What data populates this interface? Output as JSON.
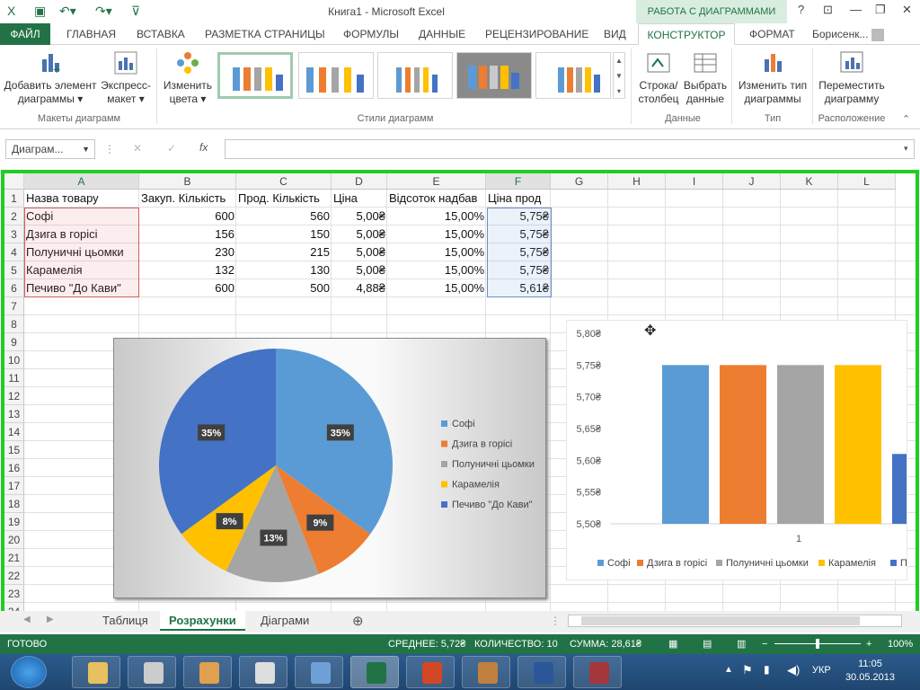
{
  "window": {
    "doc_title": "Книга1 - Microsoft Excel",
    "context_label": "РАБОТА С ДИАГРАММАМИ",
    "user": "Борисенк..."
  },
  "tabs": [
    "ФАЙЛ",
    "ГЛАВНАЯ",
    "ВСТАВКА",
    "РАЗМЕТКА СТРАНИЦЫ",
    "ФОРМУЛЫ",
    "ДАННЫЕ",
    "РЕЦЕНЗИРОВАНИЕ",
    "ВИД",
    "КОНСТРУКТОР",
    "ФОРМАТ"
  ],
  "ribbon": {
    "add_element_1": "Добавить элемент",
    "add_element_2": "диаграммы ▾",
    "express_1": "Экспресс-",
    "express_2": "макет ▾",
    "change_colors_1": "Изменить",
    "change_colors_2": "цвета ▾",
    "row_col_1": "Строка/",
    "row_col_2": "столбец",
    "select_data_1": "Выбрать",
    "select_data_2": "данные",
    "change_type_1": "Изменить тип",
    "change_type_2": "диаграммы",
    "move_1": "Переместить",
    "move_2": "диаграмму",
    "group_layouts": "Макеты диаграмм",
    "group_styles": "Стили диаграмм",
    "group_data": "Данные",
    "group_type": "Тип",
    "group_location": "Расположение"
  },
  "formula_bar": {
    "name_box": "Диаграм...",
    "fx": "fx",
    "value": ""
  },
  "columns": [
    "A",
    "B",
    "C",
    "D",
    "E",
    "F",
    "G",
    "H",
    "I",
    "J",
    "K",
    "L"
  ],
  "rows": [
    "1",
    "2",
    "3",
    "4",
    "5",
    "6",
    "7",
    "8",
    "9",
    "10",
    "11",
    "12",
    "13",
    "14",
    "15",
    "16",
    "17",
    "18",
    "19",
    "20",
    "21",
    "22",
    "23",
    "24"
  ],
  "table": {
    "headers": [
      "Назва товару",
      "Закуп. Кількість",
      "Прод. Кількість",
      "Ціна",
      "Відсоток надбав",
      "Ціна прод"
    ],
    "rows": [
      [
        "Софі",
        "600",
        "560",
        "5,00₴",
        "15,00%",
        "5,75₴"
      ],
      [
        "Дзига в горісі",
        "156",
        "150",
        "5,00₴",
        "15,00%",
        "5,75₴"
      ],
      [
        "Полуничні цьомки",
        "230",
        "215",
        "5,00₴",
        "15,00%",
        "5,75₴"
      ],
      [
        "Карамелія",
        "132",
        "130",
        "5,00₴",
        "15,00%",
        "5,75₴"
      ],
      [
        "Печиво \"До Кави\"",
        "600",
        "500",
        "4,88₴",
        "15,00%",
        "5,61₴"
      ]
    ]
  },
  "chart_data": [
    {
      "type": "pie",
      "categories": [
        "Софі",
        "Дзига в горісі",
        "Полуничні цьомки",
        "Карамелія",
        "Печиво \"До Кави\""
      ],
      "values": [
        35,
        9,
        13,
        8,
        35
      ],
      "labels": [
        "35%",
        "9%",
        "13%",
        "8%",
        "35%"
      ],
      "colors": [
        "#5b9bd5",
        "#ed7d31",
        "#a5a5a5",
        "#ffc000",
        "#4472c4"
      ],
      "legend": "right"
    },
    {
      "type": "bar",
      "categories": [
        "1"
      ],
      "series": [
        {
          "name": "Софі",
          "values": [
            5.75
          ]
        },
        {
          "name": "Дзига в горісі",
          "values": [
            5.75
          ]
        },
        {
          "name": "Полуничні цьомки",
          "values": [
            5.75
          ]
        },
        {
          "name": "Карамелія",
          "values": [
            5.75
          ]
        },
        {
          "name": "Пе",
          "values": [
            5.61
          ]
        }
      ],
      "colors": [
        "#5b9bd5",
        "#ed7d31",
        "#a5a5a5",
        "#ffc000",
        "#4472c4"
      ],
      "ylim": [
        5.5,
        5.8
      ],
      "yticks": [
        "5,80₴",
        "5,75₴",
        "5,70₴",
        "5,65₴",
        "5,60₴",
        "5,55₴",
        "5,50₴"
      ],
      "legend": "bottom"
    }
  ],
  "sheet_tabs": [
    "Таблиця",
    "Розрахунки",
    "Діаграми"
  ],
  "status": {
    "ready": "ГОТОВО",
    "average": "СРЕДНЕЕ: 5,72₴",
    "count": "КОЛИЧЕСТВО: 10",
    "sum": "СУММА: 28,61₴",
    "zoom": "100%"
  },
  "taskbar": {
    "lang": "УКР",
    "time": "11:05",
    "date": "30.05.2013"
  }
}
